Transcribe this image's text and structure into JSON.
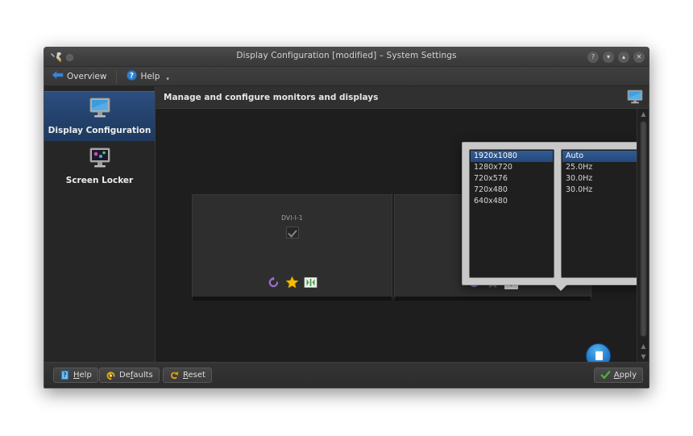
{
  "window": {
    "title": "Display Configuration [modified] – System Settings",
    "titlebar_buttons": [
      {
        "name": "help-button",
        "glyph": "?"
      },
      {
        "name": "minimize-button",
        "glyph": "▾"
      },
      {
        "name": "maximize-button",
        "glyph": "▴"
      },
      {
        "name": "close-button",
        "glyph": "✕"
      }
    ]
  },
  "toolbar": {
    "overview_label": "Overview",
    "help_label": "Help",
    "overview_icon": "back-arrow-icon",
    "help_icon": "help-circle-icon",
    "chevron": "▾"
  },
  "sidebar": {
    "items": [
      {
        "label": "Display Configuration",
        "icon": "monitor-icon",
        "active": true
      },
      {
        "label": "Screen Locker",
        "icon": "screen-locker-icon",
        "active": false
      }
    ]
  },
  "pane": {
    "header_title": "Manage and configure monitors and displays",
    "header_icon": "monitor-icon"
  },
  "monitors": [
    {
      "name": "DVI-I-1",
      "enabled": true,
      "checkbox_glyph": "✓",
      "icons": [
        {
          "name": "rotate-icon",
          "state": "enabled"
        },
        {
          "name": "primary-star-icon",
          "state": "enabled"
        },
        {
          "name": "resolution-resize-icon",
          "state": "enabled"
        }
      ]
    },
    {
      "name": "",
      "enabled": true,
      "checkbox_glyph": "✓",
      "icons": [
        {
          "name": "rotate-icon",
          "state": "enabled"
        },
        {
          "name": "primary-star-icon",
          "state": "disabled"
        },
        {
          "name": "resolution-resize-icon",
          "state": "active"
        }
      ]
    }
  ],
  "popup": {
    "resolutions": [
      {
        "label": "1920x1080",
        "selected": true
      },
      {
        "label": "1280x720",
        "selected": false
      },
      {
        "label": "720x576",
        "selected": false
      },
      {
        "label": "720x480",
        "selected": false
      },
      {
        "label": "640x480",
        "selected": false
      }
    ],
    "refresh_rates": [
      {
        "label": "Auto",
        "selected": true
      },
      {
        "label": "25.0Hz",
        "selected": false
      },
      {
        "label": "30.0Hz",
        "selected": false
      },
      {
        "label": "30.0Hz",
        "selected": false
      }
    ]
  },
  "scrollbar": {
    "up_glyph": "▲",
    "down_glyph": "▼"
  },
  "buttons": {
    "help": "Help",
    "defaults": "Defaults",
    "reset": "Reset",
    "apply": "Apply"
  },
  "colors": {
    "selection_blue": "#26487a",
    "accent_blue": "#2b87d4",
    "window_bg": "#2b2b2b",
    "content_bg": "#1e1e1e",
    "popup_bg": "#c8c8c8",
    "star_gold": "#f6c000",
    "rotate_purple": "#9b6fd4",
    "resize_green": "#3fa33f",
    "check_green": "#4caf50"
  }
}
